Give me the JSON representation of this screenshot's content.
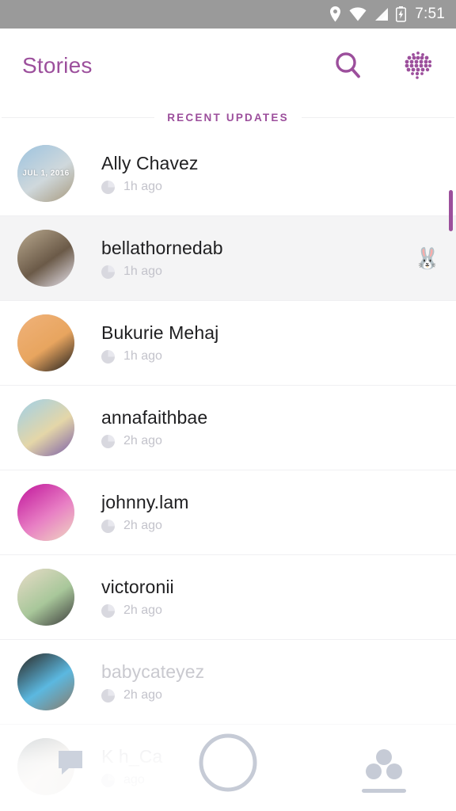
{
  "status_bar": {
    "time": "7:51",
    "icons": [
      "location-pin-icon",
      "wifi-icon",
      "cellular-signal-icon",
      "battery-charging-icon"
    ]
  },
  "header": {
    "title": "Stories",
    "search_icon": "search-icon",
    "discover_icon": "discover-dots-icon",
    "accent_color": "#9c4f9c"
  },
  "section": {
    "label": "RECENT UPDATES"
  },
  "stories": [
    {
      "username": "Ally Chavez",
      "timestamp": "1h ago",
      "date_badge": "JUL 1, 2016",
      "emoji": "",
      "viewed": false,
      "highlighted": false,
      "avatar_colors": [
        "#9cc3df",
        "#cfd8dc",
        "#a89a7e"
      ]
    },
    {
      "username": "bellathornedab",
      "timestamp": "1h ago",
      "date_badge": "",
      "emoji": "🐰",
      "viewed": false,
      "highlighted": true,
      "avatar_colors": [
        "#b9a98f",
        "#6b5a48",
        "#e8e4ee"
      ]
    },
    {
      "username": "Bukurie Mehaj",
      "timestamp": "1h ago",
      "date_badge": "",
      "emoji": "",
      "viewed": false,
      "highlighted": false,
      "avatar_colors": [
        "#f0b27a",
        "#e8a55f",
        "#1d1d1d"
      ]
    },
    {
      "username": "annafaithbae",
      "timestamp": "2h ago",
      "date_badge": "",
      "emoji": "",
      "viewed": false,
      "highlighted": false,
      "avatar_colors": [
        "#9fd0e8",
        "#e4d6a8",
        "#7b5ea8"
      ]
    },
    {
      "username": "johnny.lam",
      "timestamp": "2h ago",
      "date_badge": "",
      "emoji": "",
      "viewed": false,
      "highlighted": false,
      "avatar_colors": [
        "#c0149b",
        "#e87fc4",
        "#f0d8c0"
      ]
    },
    {
      "username": "victoronii",
      "timestamp": "2h ago",
      "date_badge": "",
      "emoji": "",
      "viewed": false,
      "highlighted": false,
      "avatar_colors": [
        "#e8dcc8",
        "#a8c79a",
        "#3b3b3b"
      ]
    },
    {
      "username": "babycateyez",
      "timestamp": "2h ago",
      "date_badge": "",
      "emoji": "",
      "viewed": true,
      "highlighted": false,
      "avatar_colors": [
        "#2a2520",
        "#5bb8e0",
        "#8a7a68"
      ]
    },
    {
      "username": "K      h_Ca",
      "timestamp": "ago",
      "date_badge": "",
      "emoji": "",
      "viewed": true,
      "highlighted": false,
      "avatar_colors": [
        "#8d9aa2",
        "#dfd6cc",
        "#b9b0a6"
      ]
    }
  ],
  "bottom_nav": [
    {
      "icon": "chat-bubble-icon",
      "active": false
    },
    {
      "icon": "camera-shutter-icon",
      "active": false
    },
    {
      "icon": "friends-icon",
      "active": true
    }
  ],
  "scrollbar": {
    "color": "#9c4f9c"
  }
}
